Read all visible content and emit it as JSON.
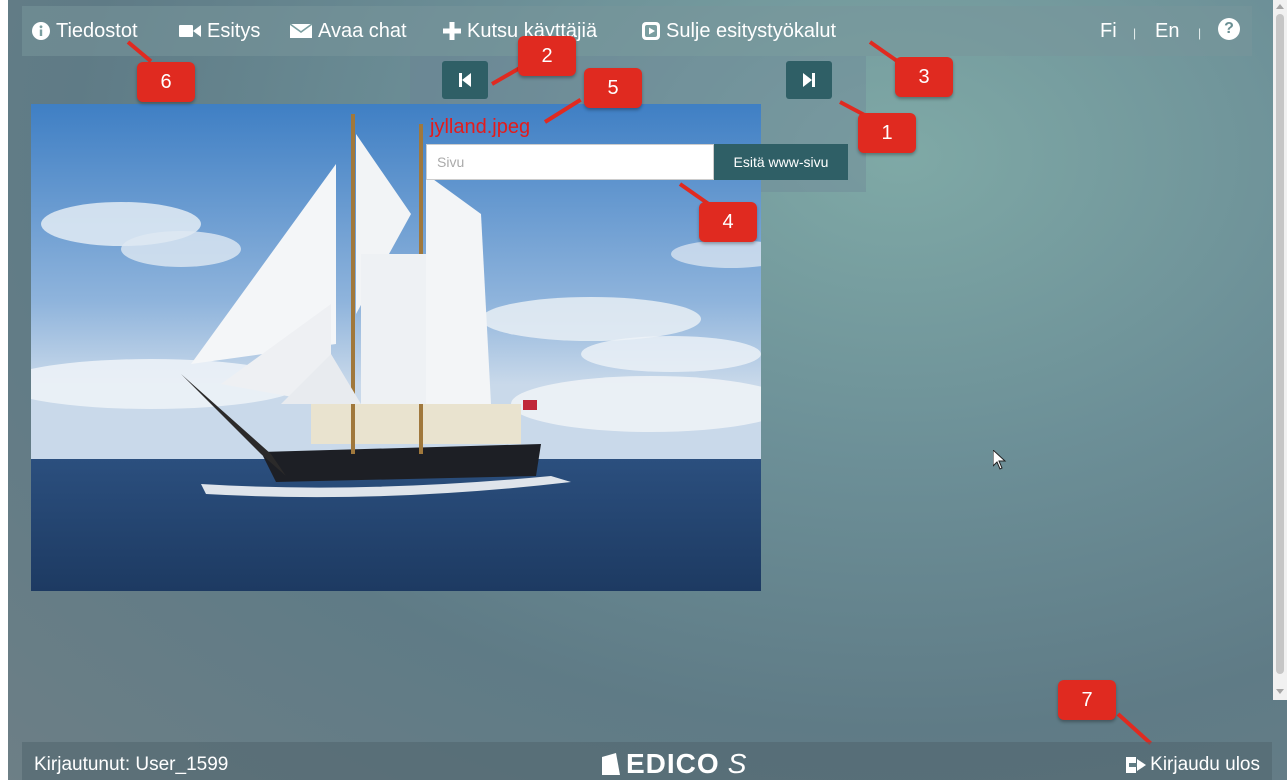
{
  "menu": {
    "files": "Tiedostot",
    "presentation": "Esitys",
    "open_chat": "Avaa chat",
    "invite_users": "Kutsu käyttäjiä",
    "close_tools": "Sulje esitystyökalut",
    "lang_fi": "Fi",
    "lang_en": "En",
    "lang_sep": "|",
    "help_icon": "question-circle-icon"
  },
  "presentation": {
    "filename": "jylland.jpeg",
    "url_placeholder": "Sivu",
    "show_button": "Esitä www-sivu",
    "prev_icon": "step-backward-icon",
    "next_icon": "step-forward-icon"
  },
  "annotations": [
    "1",
    "2",
    "3",
    "4",
    "5",
    "6",
    "7"
  ],
  "footer": {
    "logged_in": "Kirjautunut: User_1599",
    "logo_text": "EDICO",
    "logo_suffix": "S",
    "logout": "Kirjaudu ulos"
  },
  "colors": {
    "accent": "#2f5f66",
    "badge": "#e02a20",
    "filename": "#e41b1b"
  }
}
